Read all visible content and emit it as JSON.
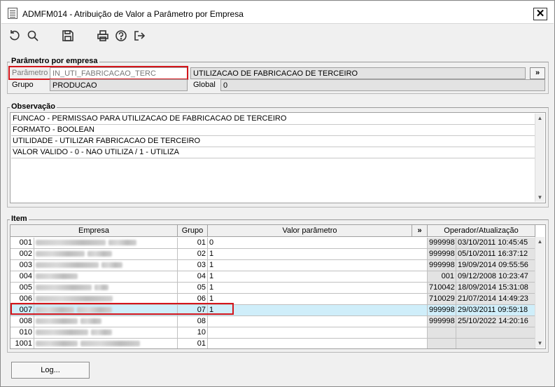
{
  "window": {
    "title": "ADMFM014 - Atribuição de Valor a Parâmetro por Empresa",
    "close_label": "✕"
  },
  "toolbar": {
    "buttons": [
      {
        "name": "refresh-icon"
      },
      {
        "name": "search-icon"
      },
      {
        "name": "save-icon"
      },
      {
        "name": "print-icon"
      },
      {
        "name": "help-icon"
      },
      {
        "name": "exit-icon"
      }
    ]
  },
  "parametro": {
    "section_title": "Parâmetro por empresa",
    "param_label": "Parâmetro",
    "param_value": "IN_UTI_FABRICACAO_TERC",
    "param_desc": "UTILIZACAO DE FABRICACAO DE TERCEIRO",
    "lookup_label": "»",
    "grupo_label": "Grupo",
    "grupo_value": "PRODUCAO",
    "global_label": "Global",
    "global_value": "0"
  },
  "observacao": {
    "section_title": "Observação",
    "lines": [
      "FUNCAO - PERMISSAO PARA UTILIZACAO DE FABRICACAO DE TERCEIRO",
      "FORMATO - BOOLEAN",
      "UTILIDADE - UTILIZAR FABRICACAO DE TERCEIRO",
      "VALOR VALIDO - 0 - NAO UTILIZA / 1 - UTILIZA"
    ]
  },
  "item": {
    "section_title": "Item",
    "headers": {
      "empresa": "Empresa",
      "grupo": "Grupo",
      "valor": "Valor parâmetro",
      "expand": "»",
      "operador": "Operador/Atualização"
    },
    "rows": [
      {
        "code": "001",
        "grupo": "01",
        "valor": "0",
        "operador": "999998",
        "data": "03/10/2011 10:45:45"
      },
      {
        "code": "002",
        "grupo": "02",
        "valor": "1",
        "operador": "999998",
        "data": "05/10/2011 16:37:12"
      },
      {
        "code": "003",
        "grupo": "03",
        "valor": "1",
        "operador": "999998",
        "data": "19/09/2014 09:55:56"
      },
      {
        "code": "004",
        "grupo": "04",
        "valor": "1",
        "operador": "001",
        "data": "09/12/2008 10:23:47"
      },
      {
        "code": "005",
        "grupo": "05",
        "valor": "1",
        "operador": "710042",
        "data": "18/09/2014 15:31:08"
      },
      {
        "code": "006",
        "grupo": "06",
        "valor": "1",
        "operador": "710029",
        "data": "21/07/2014 14:49:23"
      },
      {
        "code": "007",
        "grupo": "07",
        "valor": "1",
        "operador": "999998",
        "data": "29/03/2011 09:59:18"
      },
      {
        "code": "008",
        "grupo": "08",
        "valor": "",
        "operador": "999998",
        "data": "25/10/2022 14:20:16"
      },
      {
        "code": "010",
        "grupo": "10",
        "valor": "",
        "operador": "",
        "data": ""
      },
      {
        "code": "1001",
        "grupo": "01",
        "valor": "",
        "operador": "",
        "data": ""
      }
    ]
  },
  "footer": {
    "log_label": "Log..."
  }
}
